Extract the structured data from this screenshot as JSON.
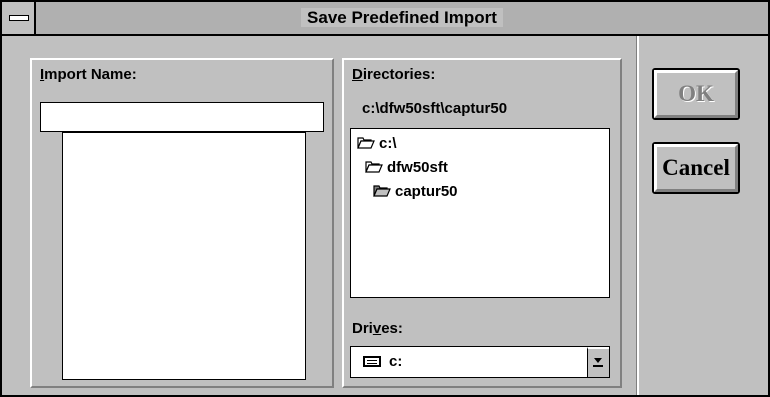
{
  "window": {
    "title": "Save Predefined Import"
  },
  "import_name": {
    "label_hotkey": "I",
    "label_rest": "mport Name:",
    "value": "",
    "items": []
  },
  "directories": {
    "label_hotkey": "D",
    "label_rest": "irectories:",
    "current_path": "c:\\dfw50sft\\captur50",
    "items": [
      {
        "name": "c:\\",
        "icon": "folder-open-icon"
      },
      {
        "name": "dfw50sft",
        "icon": "folder-open-icon"
      },
      {
        "name": "captur50",
        "icon": "folder-open-selected-icon"
      }
    ]
  },
  "drives": {
    "label_pre": "Dri",
    "label_hotkey": "v",
    "label_rest": "es:",
    "selected": "c:",
    "icon": "hard-drive-icon"
  },
  "buttons": {
    "ok": "OK",
    "cancel": "Cancel"
  }
}
